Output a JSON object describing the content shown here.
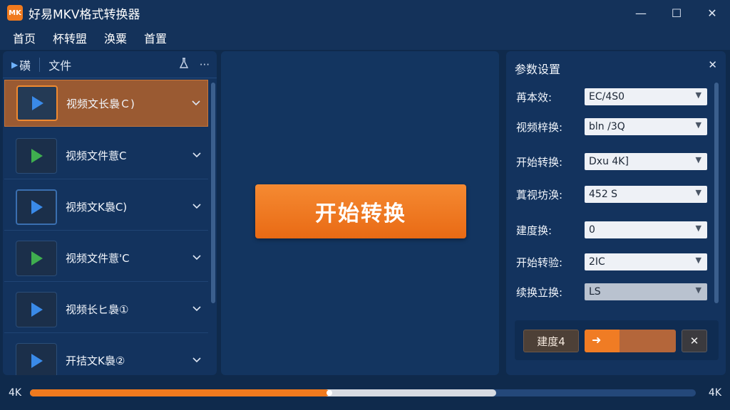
{
  "window": {
    "logo_text": "MK",
    "title": "好易MKV格式转换器",
    "minimize": "—",
    "maximize": "☐",
    "close": "✕"
  },
  "menu": [
    "首页",
    "杯转盟",
    "涣粟",
    "首置"
  ],
  "left_panel": {
    "tab1": "磺",
    "tab2": "文件",
    "icon1": "flask-icon",
    "icon2": "more-icon",
    "files": [
      {
        "name": "视频文长裊Ｃ)",
        "icon_color": "#3a8ae8",
        "selected": true
      },
      {
        "name": "视频文件薏C",
        "icon_color": "#3fae4f",
        "selected": false
      },
      {
        "name": "视频文K裊C)",
        "icon_color": "#3a8ae8",
        "selected": false
      },
      {
        "name": "视频文件薏'C",
        "icon_color": "#3fae4f",
        "selected": false
      },
      {
        "name": "视频长ヒ裊①",
        "icon_color": "#3a8ae8",
        "selected": false
      },
      {
        "name": "开拮文K裊②",
        "icon_color": "#3a8ae8",
        "selected": false
      }
    ]
  },
  "center": {
    "start_button": "开始转换"
  },
  "settings": {
    "title": "参数设置",
    "close": "✕",
    "rows": [
      {
        "label": "苒本效:",
        "value": "EC/4S0"
      },
      {
        "label": "视频梓换:",
        "value": "bln /3Q"
      },
      {
        "label": "开始转换:",
        "value": "Dxu 4K]"
      },
      {
        "label": "蒖视坊涣:",
        "value": "452 S"
      },
      {
        "label": "建度换:",
        "value": "0"
      },
      {
        "label": "开始转验:",
        "value": "2IC"
      },
      {
        "label": "续换立换:",
        "value": "LS"
      }
    ],
    "footer": {
      "speed_label": "建度4",
      "speed_fraction": 0.38,
      "cancel": "✕"
    }
  },
  "bottom": {
    "left_label": "4K",
    "right_label": "4K",
    "progress_fraction": 0.45,
    "buffer_fraction": 0.7
  }
}
